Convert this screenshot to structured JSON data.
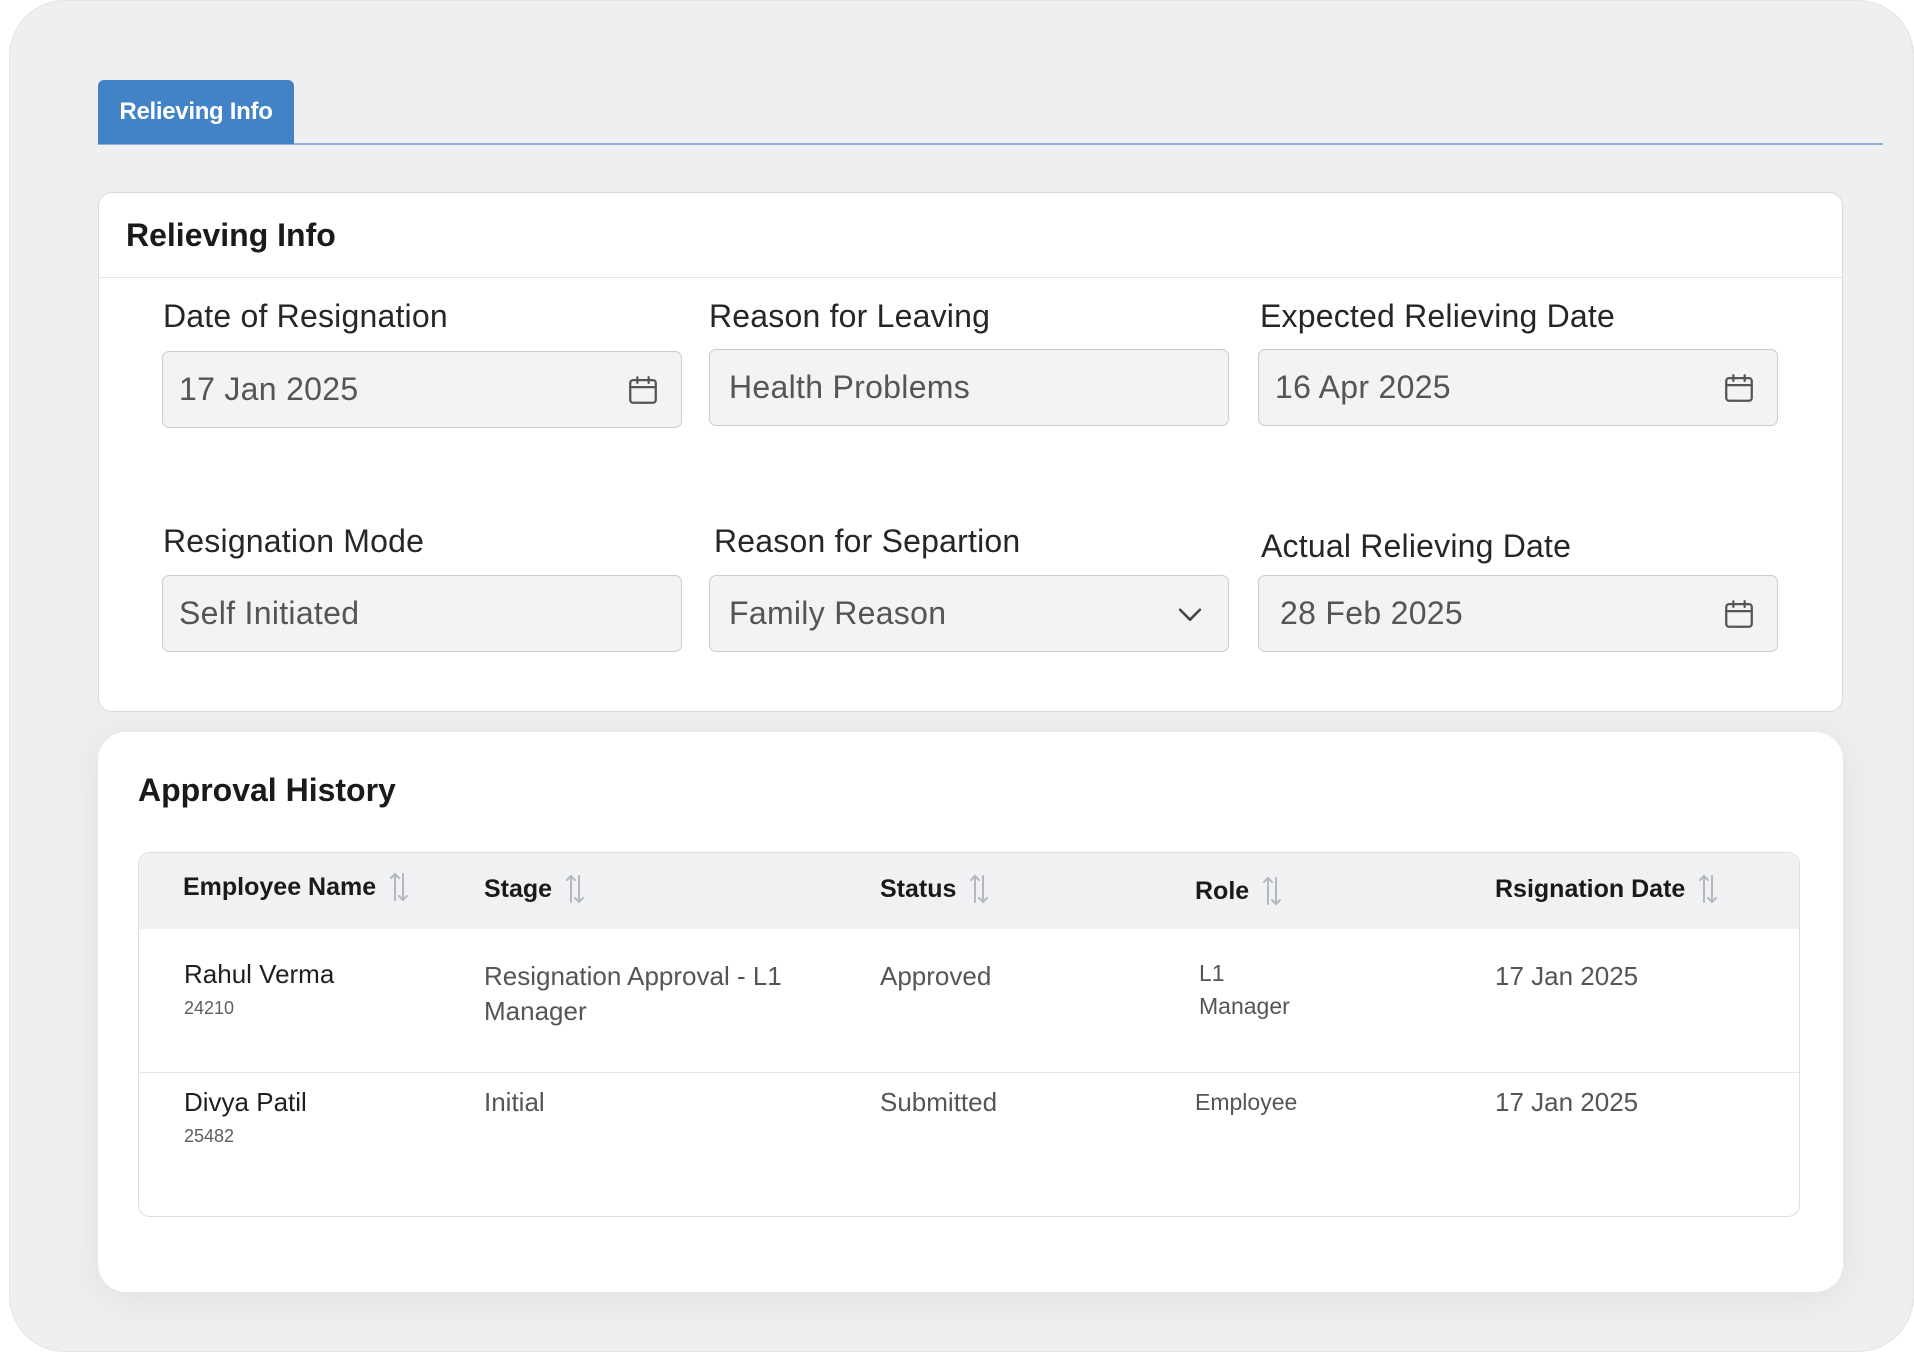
{
  "tabs": [
    {
      "label": "Relieving Info",
      "active": true
    }
  ],
  "relieving": {
    "title": "Relieving Info",
    "date_of_resignation": {
      "label": "Date of Resignation",
      "value": "17 Jan 2025"
    },
    "reason_for_leaving": {
      "label": "Reason for Leaving",
      "value": "Health Problems"
    },
    "expected_relieving_date": {
      "label": "Expected Relieving Date",
      "value": "16 Apr 2025"
    },
    "resignation_mode": {
      "label": "Resignation Mode",
      "value": "Self Initiated"
    },
    "reason_for_separation": {
      "label": "Reason for Separtion",
      "value": "Family Reason"
    },
    "actual_relieving_date": {
      "label": "Actual Relieving Date",
      "value": "28 Feb 2025"
    }
  },
  "approval": {
    "title": "Approval History",
    "columns": [
      "Employee Name",
      "Stage",
      "Status",
      "Role",
      "Rsignation Date"
    ],
    "rows": [
      {
        "name": "Rahul Verma",
        "id": "24210",
        "stage": "Resignation Approval - L1 Manager",
        "status": "Approved",
        "role": "L1 Manager",
        "date": "17 Jan 2025"
      },
      {
        "name": "Divya Patil",
        "id": "25482",
        "stage": "Initial",
        "status": "Submitted",
        "role": "Employee",
        "date": "17 Jan 2025"
      }
    ]
  },
  "colors": {
    "accent": "#4282c6",
    "tab_underline": "#8fb0d4",
    "background": "#eeeff1"
  },
  "icons": {
    "date_picker": "calendar-icon",
    "dropdown": "chevron-down-icon",
    "sort": "sort-arrows-icon"
  }
}
